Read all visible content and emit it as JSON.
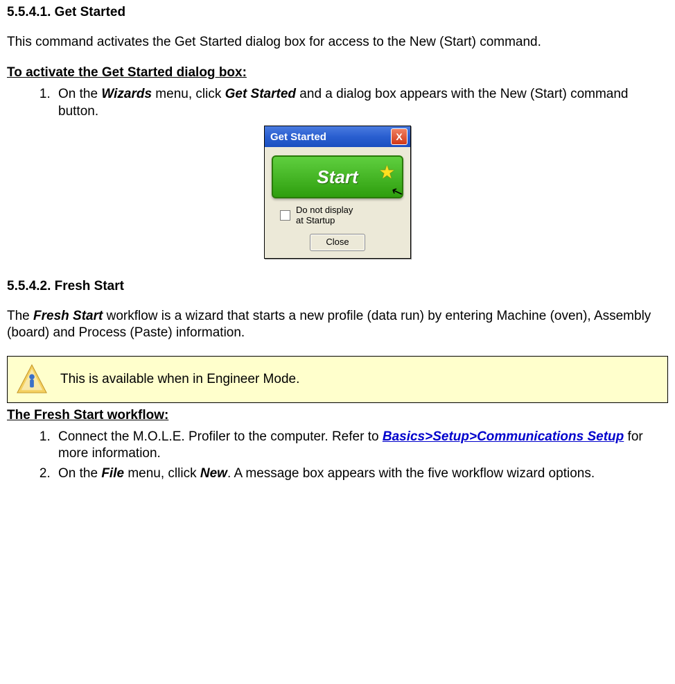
{
  "section1": {
    "heading": "5.5.4.1. Get Started",
    "intro": "This command activates the Get Started dialog box for access to the New (Start) command.",
    "subhead": "To activate the Get Started dialog box:",
    "step1_pre": "On the ",
    "step1_menu": "Wizards",
    "step1_mid": " menu, click ",
    "step1_cmd": "Get Started",
    "step1_post": " and a dialog box appears with the New (Start) command button."
  },
  "dialog": {
    "title": "Get Started",
    "close_x": "X",
    "start_label": "Start",
    "checkbox_label": "Do not display\nat Startup",
    "close_label": "Close"
  },
  "section2": {
    "heading": "5.5.4.2. Fresh Start",
    "intro_pre": "The ",
    "intro_cmd": "Fresh Start",
    "intro_post": " workflow is a wizard that starts a new profile (data run) by entering Machine (oven), Assembly (board) and Process (Paste) information.",
    "note": "This is available when in Engineer Mode.",
    "subhead": "The Fresh Start workflow:",
    "step1_pre": "Connect the M.O.L.E. Profiler to the computer. Refer to ",
    "step1_link": "Basics>Setup>Communications Setup",
    "step1_post": " for more information.",
    "step2_pre": "On the ",
    "step2_menu": "File",
    "step2_mid": " menu, cllick ",
    "step2_cmd": "New",
    "step2_post": ". A message box appears with the five workflow wizard options."
  }
}
